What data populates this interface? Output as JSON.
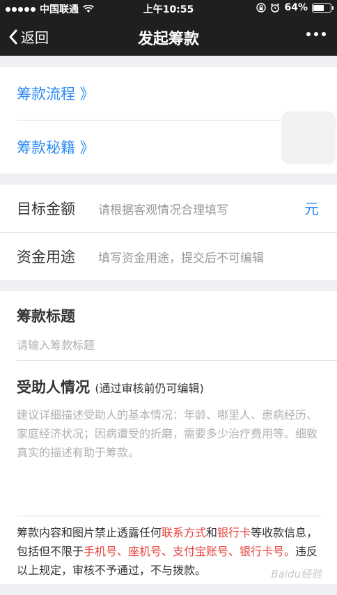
{
  "status": {
    "carrier": "中国联通",
    "time": "上午10:55",
    "battery": "64%",
    "battery_level": 0.64
  },
  "nav": {
    "back_label": "返回",
    "title": "发起筹款"
  },
  "links": {
    "process": "筹款流程 》",
    "tips": "筹款秘籍 》"
  },
  "form": {
    "amount": {
      "label": "目标金额",
      "placeholder": "请根据客观情况合理填写",
      "unit": "元"
    },
    "usage": {
      "label": "资金用途",
      "placeholder": "填写资金用途，提交后不可编辑"
    }
  },
  "title_section": {
    "heading": "筹款标题",
    "placeholder": "请输入筹款标题"
  },
  "beneficiary": {
    "heading": "受助人情况",
    "note": "(通过审核前仍可编辑)",
    "placeholder": "建议详细描述受助人的基本情况：年龄、哪里人、患病经历、家庭经济状况；因病遭受的折磨，需要多少治疗费用等。细致真实的描述有助于筹款。"
  },
  "notice": {
    "p1": "筹款内容和图片禁止透露任何",
    "contact": "联系方式",
    "and": "和",
    "bankcard": "银行卡",
    "p2": "等收款信息，包括但不限于",
    "phones": "手机号、座机号、支付宝账号、银行卡号。",
    "p3": "违反以上规定，审核不予通过，不与拨款。"
  },
  "watermark": "Baidu经验",
  "colors": {
    "accent": "#2d8cf0",
    "warning": "#e8433e",
    "bar": "#1f1f21"
  }
}
